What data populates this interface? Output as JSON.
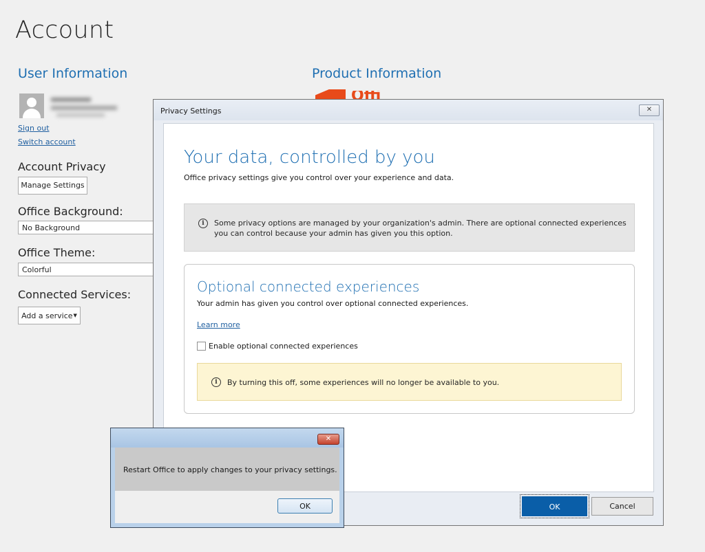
{
  "account": {
    "title": "Account",
    "user_info_heading": "User Information",
    "product_info_heading": "Product Information",
    "sign_out": "Sign out",
    "switch_account": "Switch account",
    "account_privacy_heading": "Account Privacy",
    "manage_settings": "Manage Settings",
    "office_background_heading": "Office Background:",
    "office_background_value": "No Background",
    "office_theme_heading": "Office Theme:",
    "office_theme_value": "Colorful",
    "connected_services_heading": "Connected Services:",
    "add_service": "Add a service",
    "office_logo_text": "Offi"
  },
  "privacy_dialog": {
    "title": "Privacy Settings",
    "heading": "Your data, controlled by you",
    "subheading": "Office privacy settings give you control over your experience and data.",
    "admin_notice": "Some privacy options are managed by your organization's admin. There are optional connected experiences you can control because your admin has given you this option.",
    "optional_card": {
      "heading": "Optional connected experiences",
      "description": "Your admin has given you control over optional connected experiences.",
      "learn_more": "Learn more",
      "checkbox_label": "Enable optional connected experiences",
      "checkbox_checked": false,
      "warning": "By turning this off, some experiences will no longer be available to you."
    },
    "ok_label": "OK",
    "cancel_label": "Cancel"
  },
  "restart_box": {
    "message": "Restart Office to apply changes to your privacy settings.",
    "ok_label": "OK"
  },
  "icons": {
    "info": "info-icon",
    "close": "close-icon",
    "avatar": "person-avatar-icon",
    "dropdown": "caret-down-icon"
  },
  "colors": {
    "accent": "#1f6fb2",
    "primary_button": "#0a5ea8",
    "warning_bg": "#fdf5d3",
    "office_orange": "#e84a1a"
  }
}
